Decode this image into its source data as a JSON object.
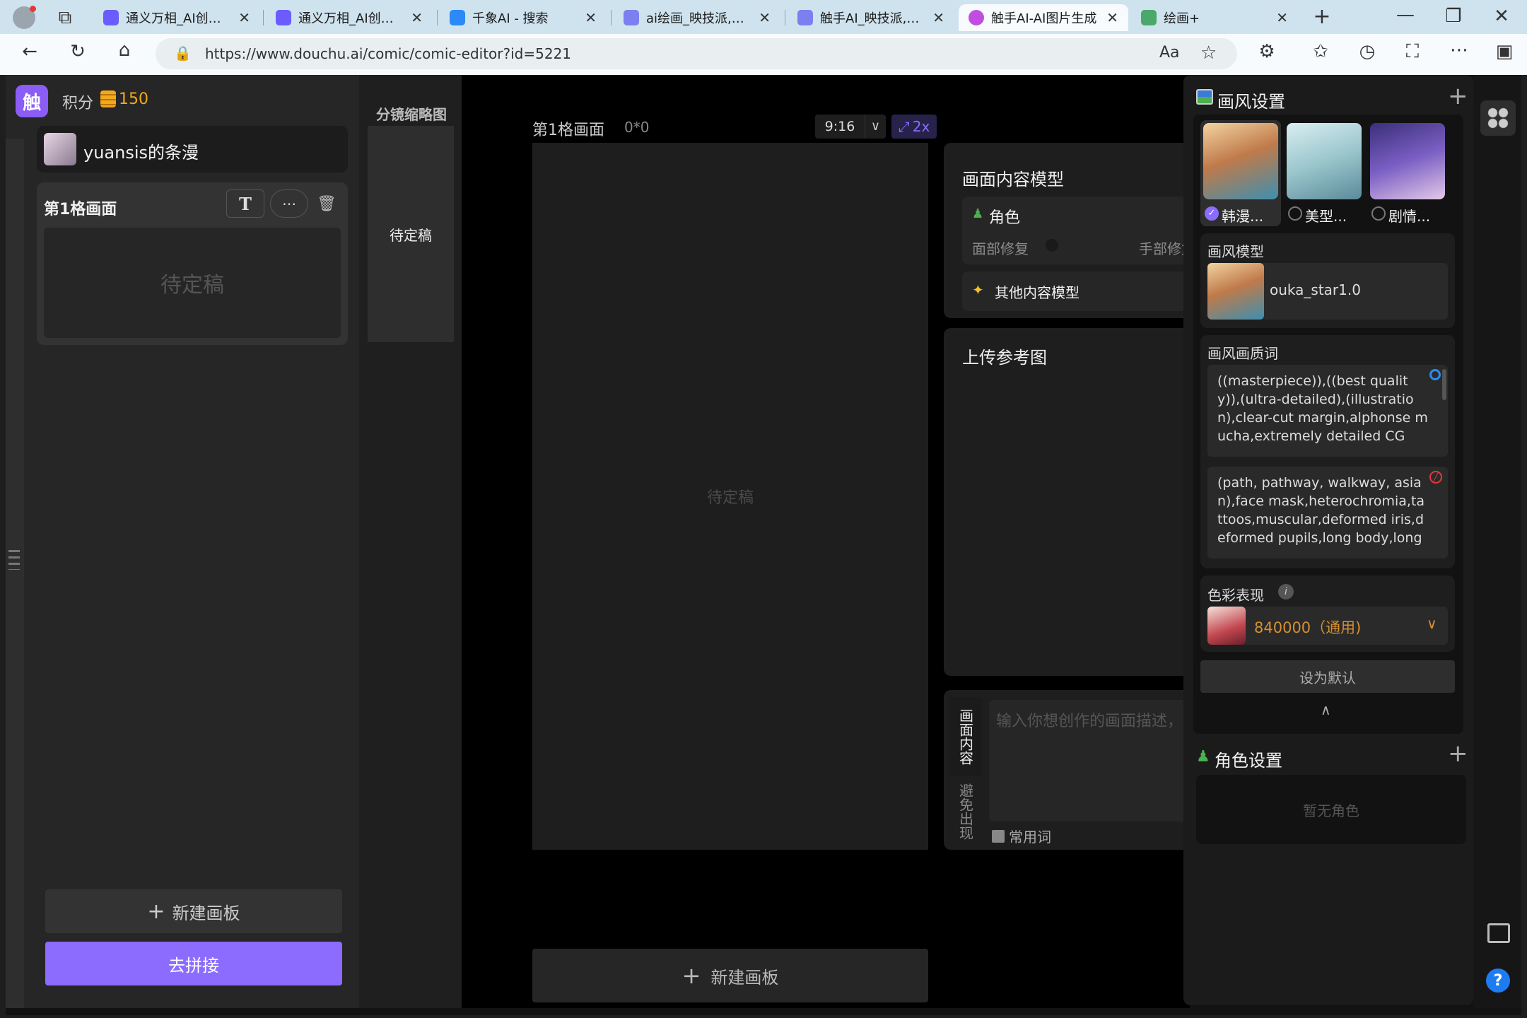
{
  "browser": {
    "tabs": [
      {
        "title": "通义万相_AI创意作"
      },
      {
        "title": "通义万相_AI创意作"
      },
      {
        "title": "千象AI - 搜索"
      },
      {
        "title": "ai绘画_映技派,专注"
      },
      {
        "title": "触手AI_映技派,专注"
      },
      {
        "title": "触手AI-AI图片生成"
      },
      {
        "title": "绘画+"
      }
    ],
    "url": "https://www.douchu.ai/comic/comic-editor?id=5221"
  },
  "left": {
    "logo": "触",
    "points_label": "积分",
    "points_value": "150",
    "project_name": "yuansis的条漫",
    "panel_title": "第1格画面",
    "panel_placeholder": "待定稿",
    "new_board": "新建画板",
    "go_stitch": "去拼接"
  },
  "thumbs": {
    "header": "分镜缩略图",
    "item": "待定稿"
  },
  "canvas": {
    "title": "第1格画面",
    "coords": "0*0",
    "ratio": "9:16",
    "scale": "2x",
    "placeholder": "待定稿",
    "new_board": "新建画板"
  },
  "middle": {
    "content_model_title": "画面内容模型",
    "role_label": "角色",
    "face_fix": "面部修复",
    "hand_fix": "手部修复",
    "other_models": "其他内容模型",
    "upload_title": "上传参考图",
    "tab_content": "画面内容",
    "tab_avoid": "避免出现",
    "prompt_placeholder": "输入你想创作的画面描述，",
    "common_words": "常用词"
  },
  "right": {
    "style_title": "画风设置",
    "styles": [
      {
        "label": "韩漫...",
        "selected": true
      },
      {
        "label": "美型...",
        "selected": false
      },
      {
        "label": "剧情...",
        "selected": false
      }
    ],
    "model_section": "画风模型",
    "model_name": "ouka_star1.0",
    "quality_section": "画风画质词",
    "positive_prompt": "((masterpiece)),((best quality)),(ultra-detailed),(illustration),clear-cut margin,alphonse mucha,extremely detailed CG",
    "negative_prompt": "(path, pathway, walkway, asian),face mask,heterochromia,tattoos,muscular,deformed iris,deformed pupils,long body,long",
    "color_section": "色彩表现",
    "color_value": "840000（通用)",
    "set_default": "设为默认",
    "role_title": "角色设置",
    "no_role": "暂无角色"
  },
  "colors": {
    "accent": "#8b6cff",
    "coin": "#f2a91d",
    "panel": "#2a2a2a"
  }
}
